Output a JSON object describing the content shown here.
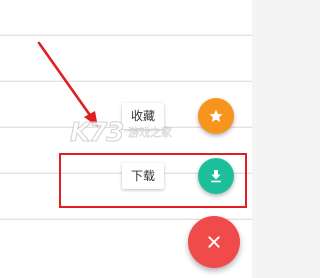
{
  "fab_menu": {
    "items": [
      {
        "label": "收藏",
        "icon": "star-icon",
        "color": "#f7941d"
      },
      {
        "label": "下载",
        "icon": "download-icon",
        "color": "#1dbf9a"
      }
    ],
    "main": {
      "icon": "close-icon",
      "color": "#f04a4a"
    }
  },
  "watermark": {
    "logo": "K73",
    "subtitle": "游戏之家"
  },
  "annotation": {
    "color": "#e02020"
  }
}
